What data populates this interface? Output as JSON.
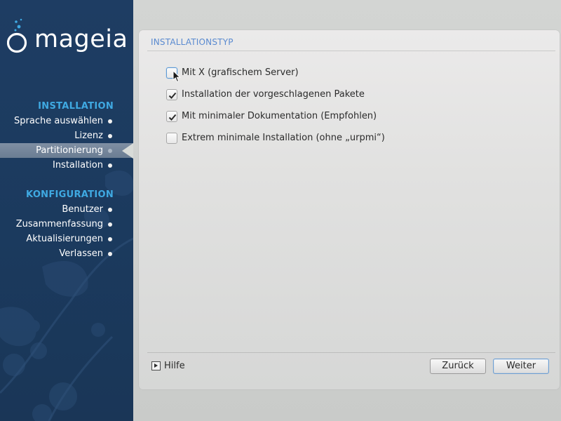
{
  "brand": {
    "name": "mageia"
  },
  "sidebar": {
    "sections": [
      {
        "heading": "INSTALLATION",
        "items": [
          {
            "label": "Sprache auswählen",
            "active": false
          },
          {
            "label": "Lizenz",
            "active": false
          },
          {
            "label": "Partitionierung",
            "active": true
          },
          {
            "label": "Installation",
            "active": false
          }
        ]
      },
      {
        "heading": "KONFIGURATION",
        "items": [
          {
            "label": "Benutzer",
            "active": false
          },
          {
            "label": "Zusammenfassung",
            "active": false
          },
          {
            "label": "Aktualisierungen",
            "active": false
          },
          {
            "label": "Verlassen",
            "active": false
          }
        ]
      }
    ]
  },
  "main": {
    "title": "INSTALLATIONSTYP",
    "options": [
      {
        "label": "Mit X (grafischem Server)",
        "checked": false,
        "focused": true
      },
      {
        "label": "Installation der vorgeschlagenen Pakete",
        "checked": true,
        "focused": false
      },
      {
        "label": "Mit minimaler Dokumentation (Empfohlen)",
        "checked": true,
        "focused": false
      },
      {
        "label": "Extrem minimale Installation (ohne „urpmi“)",
        "checked": false,
        "focused": false
      }
    ]
  },
  "footer": {
    "help_label": "Hilfe",
    "back_label": "Zurück",
    "next_label": "Weiter"
  },
  "colors": {
    "sidebar_bg": "#1e3d63",
    "heading_accent": "#3fa9e2",
    "title_accent": "#5a8ad0",
    "focus_accent": "#5d9ad6"
  },
  "icons": {
    "logo": "mageia-logo-icon",
    "checkmark": "checkmark-icon",
    "help": "play-triangle-icon",
    "cursor": "mouse-pointer-icon"
  }
}
